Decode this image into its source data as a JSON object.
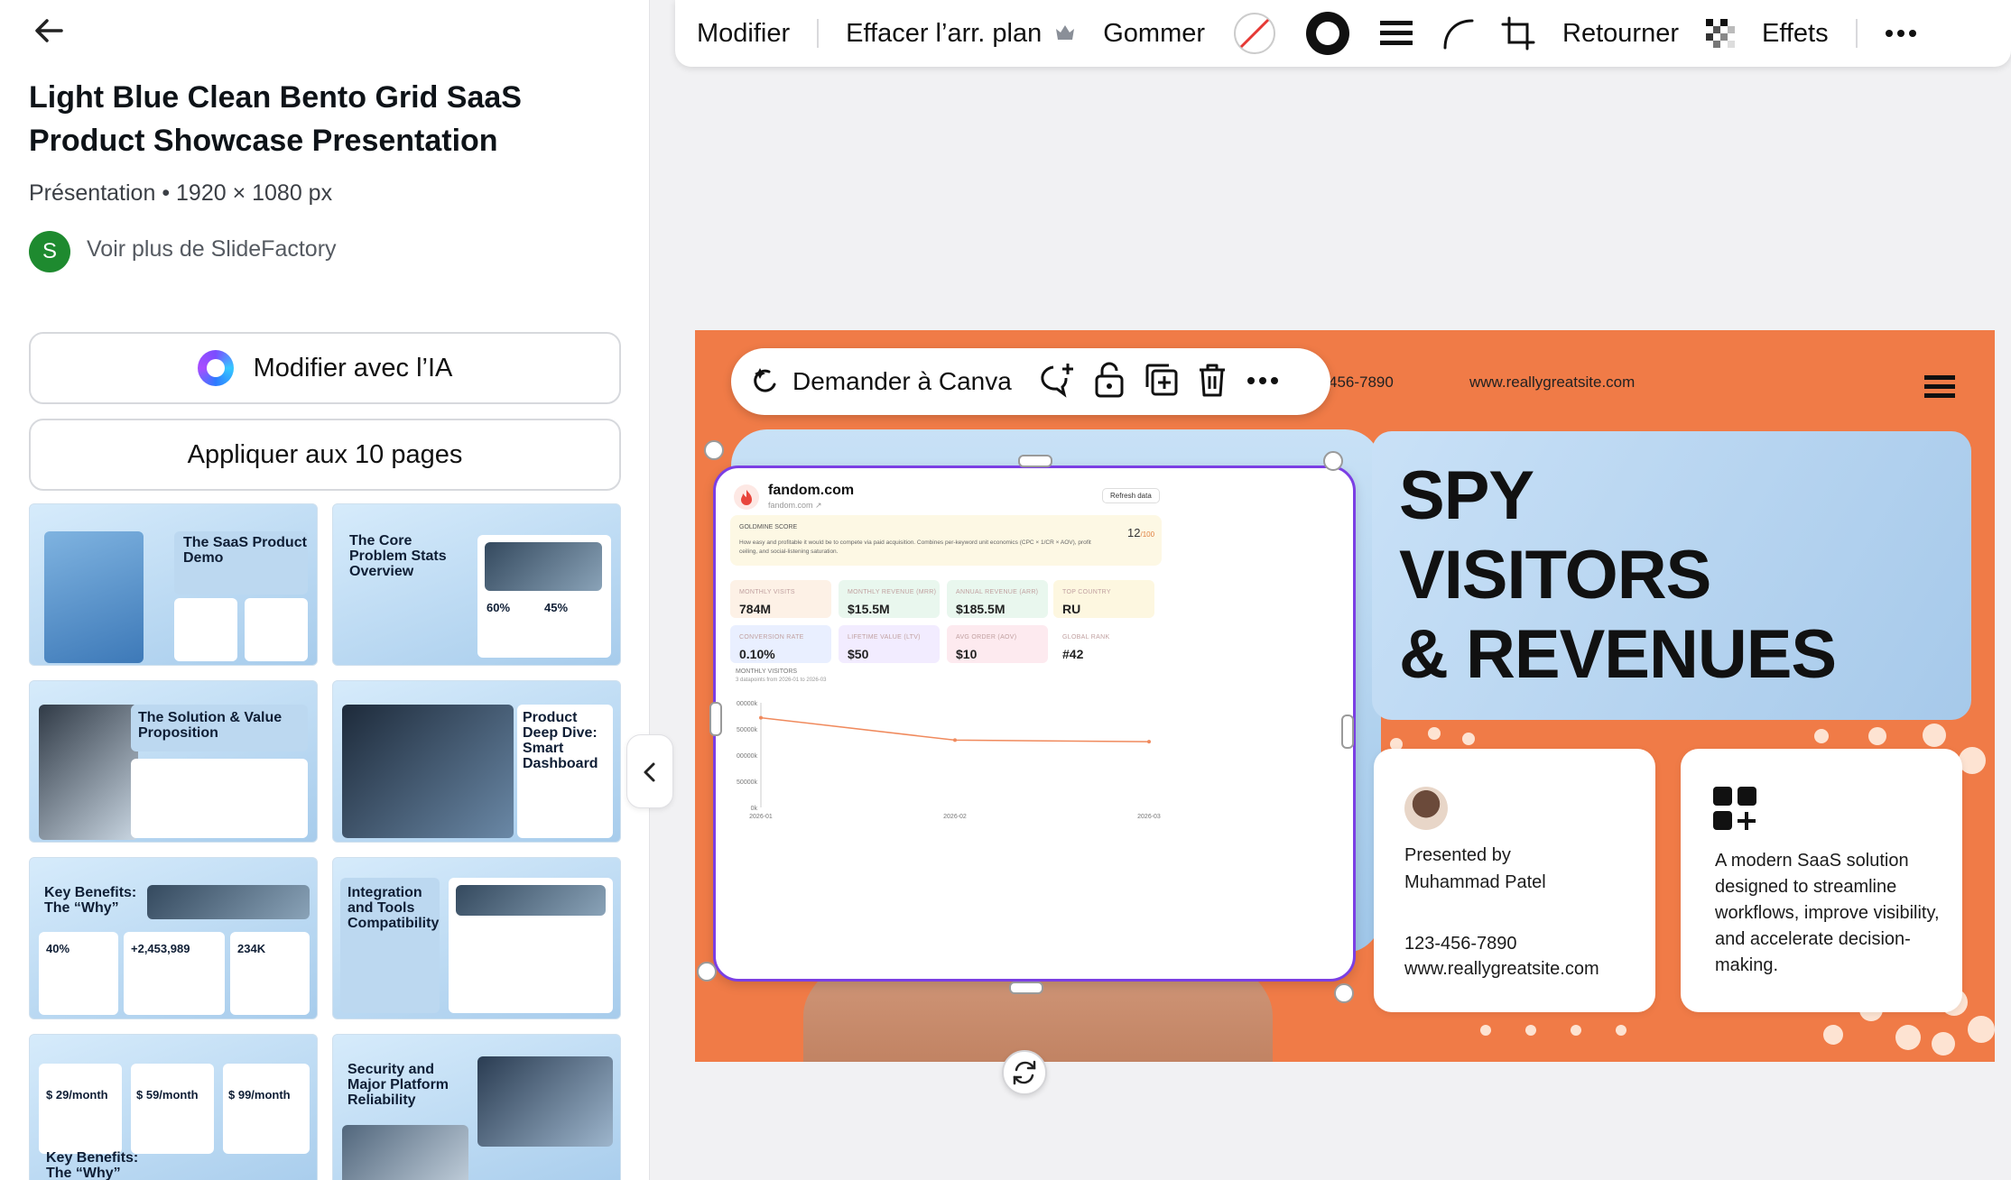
{
  "left_panel": {
    "title": "Light Blue Clean Bento Grid SaaS Product Showcase Presentation",
    "meta": "Présentation • 1920 × 1080 px",
    "author_initial": "S",
    "author_link": "Voir plus de SlideFactory",
    "ai_button": "Modifier avec l’IA",
    "apply_button": "Appliquer aux 10 pages",
    "thumbnails": [
      {
        "title": "The SaaS Product Demo"
      },
      {
        "title": "The Core Problem Stats Overview",
        "stat1": "60%",
        "stat2": "45%"
      },
      {
        "title": "The Solution & Value Proposition"
      },
      {
        "title": "Product Deep Dive: Smart Dashboard"
      },
      {
        "title": "Key Benefits: The “Why”",
        "stat1": "40%",
        "stat2": "+2,453,989",
        "stat3": "234K"
      },
      {
        "title": "Integration and Tools Compatibility"
      },
      {
        "title": "Key Benefits: The “Why”",
        "price1": "$ 29/month",
        "price2": "$ 59/month",
        "price3": "$ 99/month"
      },
      {
        "title": "Security and Major Platform Reliability"
      }
    ]
  },
  "toolbar": {
    "modifier": "Modifier",
    "remove_bg": "Effacer l’arr. plan",
    "erase": "Gommer",
    "flip": "Retourner",
    "effects": "Effets"
  },
  "ask_bar": {
    "label": "Demander à Canva"
  },
  "slide": {
    "phone_partial": "456-7890",
    "website": "www.reallygreatsite.com",
    "headline_1": "SPY",
    "headline_2": "VISITORS",
    "headline_3": "& REVENUES",
    "presented_by": "Presented by",
    "presenter": "Muhammad Patel",
    "phone": "123-456-7890",
    "site": "www.reallygreatsite.com",
    "description": "A modern SaaS solution designed to streamline workflows, improve visibility, and accelerate decision-making."
  },
  "dashboard": {
    "domain": "fandom.com",
    "subdomain": "fandom.com ↗",
    "refresh": "Refresh data",
    "score_label": "GOLDMINE SCORE",
    "score_value": "12",
    "score_max": "/100",
    "score_text": "How easy and profitable it would be to compete via paid acquisition. Combines per-keyword unit economics (CPC × 1/CR × AOV), profit ceiling, and social-listening saturation.",
    "metrics": [
      {
        "label": "MONTHLY VISITS",
        "value": "784M",
        "color": "#fdf1e6"
      },
      {
        "label": "MONTHLY REVENUE (MRR)",
        "value": "$15.5M",
        "color": "#e9f7ee"
      },
      {
        "label": "ANNUAL REVENUE (ARR)",
        "value": "$185.5M",
        "color": "#e9f7ee"
      },
      {
        "label": "TOP COUNTRY",
        "value": "RU",
        "color": "#fdf7e0"
      },
      {
        "label": "CONVERSION RATE",
        "value": "0.10%",
        "color": "#e9efff"
      },
      {
        "label": "LIFETIME VALUE (LTV)",
        "value": "$50",
        "color": "#f2ecff"
      },
      {
        "label": "AVG ORDER (AOV)",
        "value": "$10",
        "color": "#fdeaef"
      },
      {
        "label": "GLOBAL RANK",
        "value": "#42",
        "color": "#ffffff"
      }
    ],
    "chart_title": "MONTHLY VISITORS",
    "chart_sub": "3 datapoints from 2026-01 to 2026-03"
  },
  "chart_data": {
    "type": "line",
    "title": "MONTHLY VISITORS",
    "categories": [
      "2026-01",
      "2026-02",
      "2026-03"
    ],
    "series": [
      {
        "values": [
          800000,
          785000,
          784000
        ]
      }
    ],
    "ytick_labels": [
      "00000k",
      "50000k",
      "00000k",
      "50000k",
      "0k"
    ],
    "color": "#f08a5d"
  }
}
